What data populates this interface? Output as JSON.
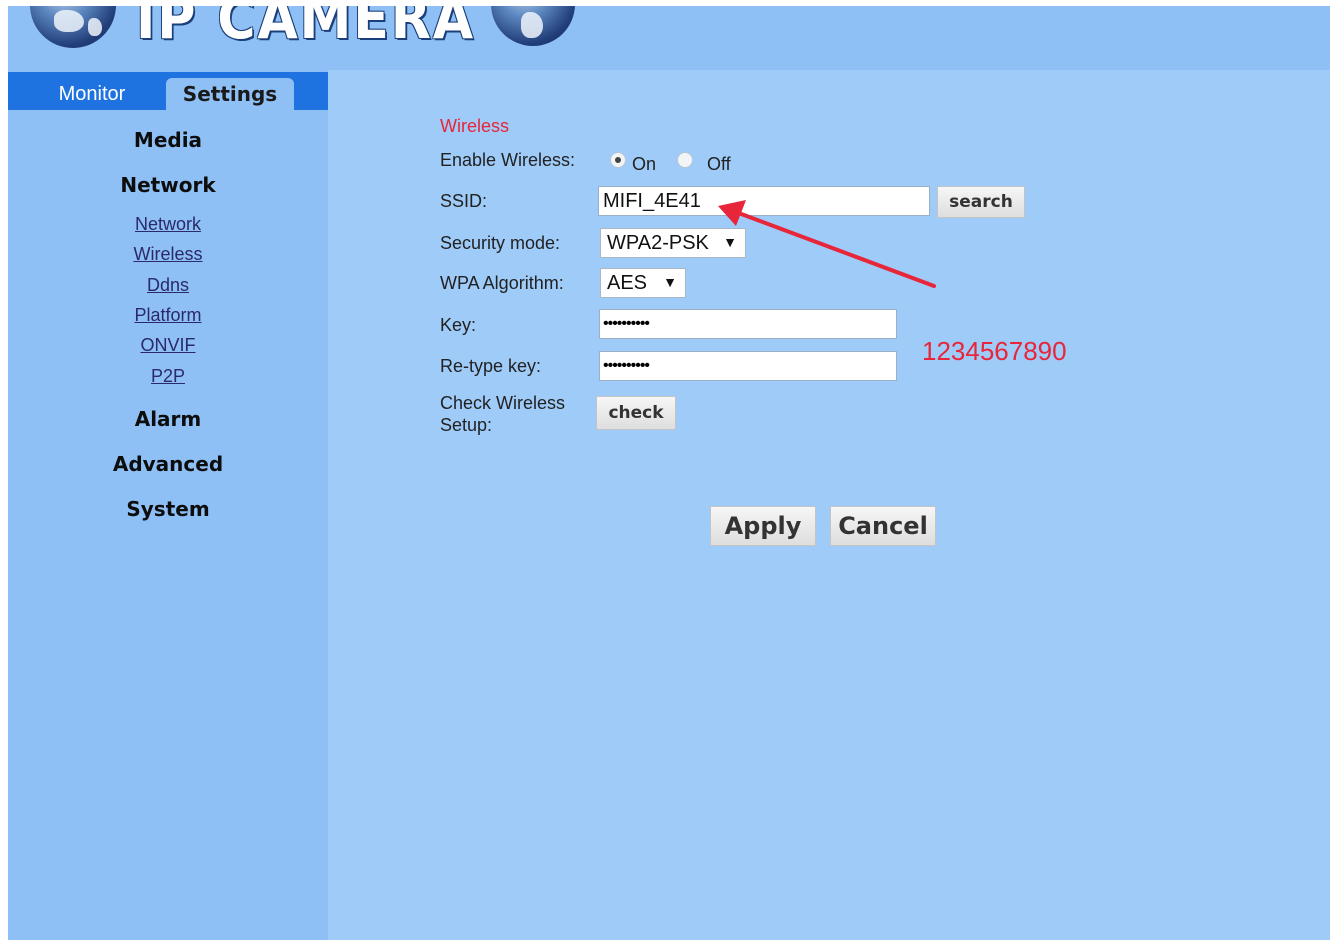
{
  "header": {
    "logo_text": "IP CAMERA"
  },
  "tabs": {
    "monitor": "Monitor",
    "settings": "Settings"
  },
  "sidebar": {
    "media": "Media",
    "network": "Network",
    "network_items": [
      "Network",
      "Wireless",
      "Ddns",
      "Platform",
      "ONVIF",
      "P2P"
    ],
    "alarm": "Alarm",
    "advanced": "Advanced",
    "system": "System"
  },
  "form": {
    "section_title": "Wireless",
    "enable_label": "Enable Wireless:",
    "on_label": "On",
    "off_label": "Off",
    "enable_value": "On",
    "ssid_label": "SSID:",
    "ssid_value": "MIFI_4E41",
    "search_button": "search",
    "security_label": "Security mode:",
    "security_value": "WPA2-PSK",
    "wpa_label": "WPA Algorithm:",
    "wpa_value": "AES",
    "key_label": "Key:",
    "key_mask": "••••••••••",
    "retype_label": "Re-type key:",
    "retype_mask": "••••••••••",
    "check_label_line1": "Check Wireless",
    "check_label_line2": "Setup:",
    "check_button": "check",
    "apply_button": "Apply",
    "cancel_button": "Cancel"
  },
  "annotation": {
    "key_hint": "1234567890",
    "arrow_color": "#e8263a"
  },
  "colors": {
    "background": "#9fcbf8",
    "sidebar": "#8ec0f5",
    "tabbar": "#1f73e0",
    "accent_red": "#e8263a"
  },
  "icons": {
    "dropdown": "triangle-down",
    "logo_globe": "globe"
  }
}
